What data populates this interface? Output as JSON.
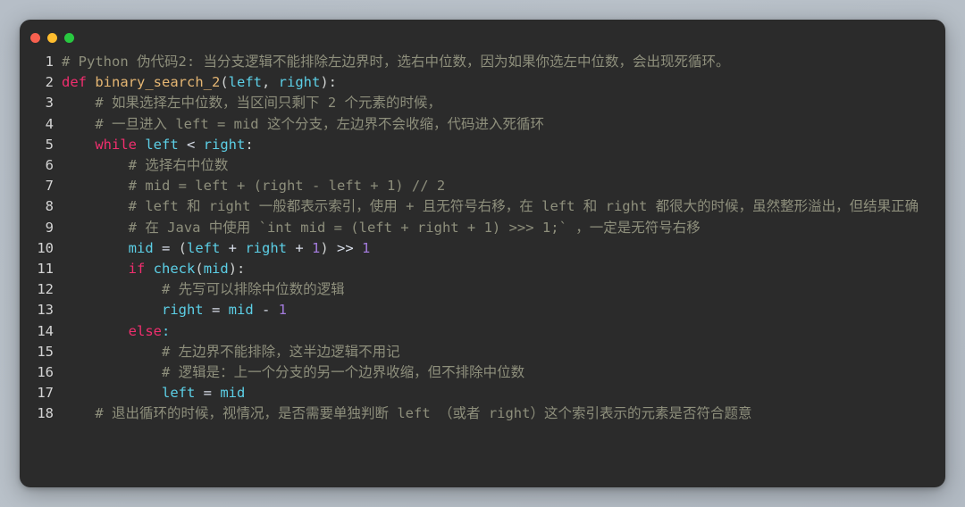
{
  "window": {
    "name": "code-snippet-window",
    "background": "#2b2b2b",
    "page_background": "#b8c0c8",
    "traffic_lights": [
      {
        "name": "close",
        "color": "#f8604f"
      },
      {
        "name": "minimize",
        "color": "#ffbd2e"
      },
      {
        "name": "maximize",
        "color": "#28c840"
      }
    ]
  },
  "colors": {
    "comment": "#8e8f7c",
    "keyword": "#f02e6e",
    "function": "#e5b673",
    "variable": "#5ccfe6",
    "number": "#a37bdc",
    "plain": "#cfd2d1",
    "line_number": "#d4d4d4"
  },
  "code": {
    "language": "Python",
    "lines": [
      {
        "n": "1",
        "text": "# Python 伪代码2: 当分支逻辑不能排除左边界时，选右中位数，因为如果你选左中位数，会出现死循环。"
      },
      {
        "n": "2",
        "text": "def binary_search_2(left, right):"
      },
      {
        "n": "3",
        "text": "    # 如果选择左中位数，当区间只剩下 2 个元素的时候，"
      },
      {
        "n": "4",
        "text": "    # 一旦进入 left = mid 这个分支，左边界不会收缩，代码进入死循环"
      },
      {
        "n": "5",
        "text": "    while left < right:"
      },
      {
        "n": "6",
        "text": "        # 选择右中位数"
      },
      {
        "n": "7",
        "text": "        # mid = left + (right - left + 1) // 2"
      },
      {
        "n": "8",
        "text": "        # left 和 right 一般都表示索引，使用 + 且无符号右移，在 left 和 right 都很大的时候，虽然整形溢出，但结果正确"
      },
      {
        "n": "9",
        "text": "        # 在 Java 中使用 `int mid = (left + right + 1) >>> 1;` ，一定是无符号右移"
      },
      {
        "n": "10",
        "text": "        mid = (left + right + 1) >> 1"
      },
      {
        "n": "11",
        "text": "        if check(mid):"
      },
      {
        "n": "12",
        "text": "            # 先写可以排除中位数的逻辑"
      },
      {
        "n": "13",
        "text": "            right = mid - 1"
      },
      {
        "n": "14",
        "text": "        else:"
      },
      {
        "n": "15",
        "text": "            # 左边界不能排除，这半边逻辑不用记"
      },
      {
        "n": "16",
        "text": "            # 逻辑是：上一个分支的另一个边界收缩，但不排除中位数"
      },
      {
        "n": "17",
        "text": "            left = mid"
      },
      {
        "n": "18",
        "text": "    # 退出循环的时候，视情况，是否需要单独判断 left （或者 right）这个索引表示的元素是否符合题意"
      }
    ]
  }
}
